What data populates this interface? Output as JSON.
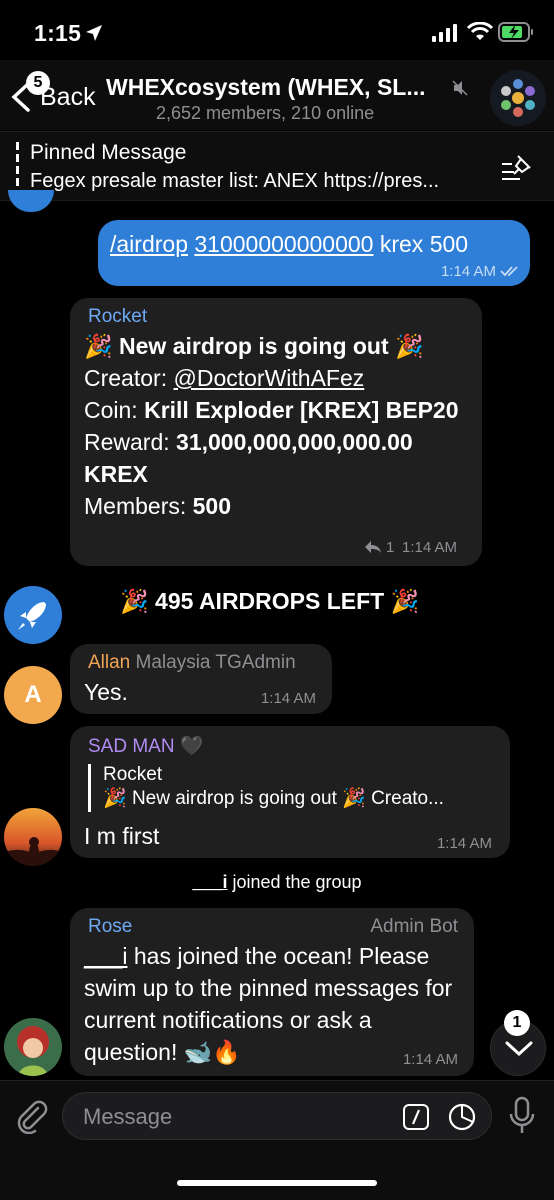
{
  "status": {
    "time": "1:15"
  },
  "header": {
    "back_label": "Back",
    "unread_count": "5",
    "title": "WHEXcosystem (WHEX, SL...",
    "subtitle": "2,652 members, 210 online"
  },
  "pinned": {
    "title": "Pinned Message",
    "text": "Fegex presale master list: ANEX https://pres..."
  },
  "messages": {
    "out": {
      "command": "/airdrop",
      "amount": "31000000000000",
      "rest": " krex 500",
      "time": "1:14 AM"
    },
    "rocket": {
      "sender": "Rocket",
      "line1": "New airdrop is going out",
      "creator_label": "Creator: ",
      "creator": "@DoctorWithAFez",
      "coin_label": "Coin: ",
      "coin": "Krill Exploder [KREX] BEP20",
      "reward_label": "Reward: ",
      "reward": "31,000,000,000,000.00 KREX",
      "members_label": "Members: ",
      "members": "500",
      "reply_count": "1",
      "time": "1:14 AM"
    },
    "airdrops_left": "495 AIRDROPS LEFT",
    "allan": {
      "sender": "Allan",
      "tag": "Malaysia TGAdmin",
      "avatar_letter": "A",
      "text": "Yes.",
      "time": "1:14 AM"
    },
    "sadman": {
      "sender": "SAD MAN",
      "reply_sender": "Rocket",
      "reply_text": "New airdrop is going out",
      "reply_tail": "Creato...",
      "text": "I m first",
      "time": "1:14 AM"
    },
    "joined": {
      "user": "___i",
      "text": " joined the group"
    },
    "rose": {
      "sender": "Rose",
      "tag": "Admin Bot",
      "user": "___i",
      "text": " has joined the ocean! Please swim up to the pinned messages for current notifications or ask a question!",
      "time": "1:14 AM"
    }
  },
  "scroll_badge": "1",
  "input": {
    "placeholder": "Message"
  },
  "colors": {
    "outgoing": "#2f7fd8",
    "rocket_name": "#6ea9f5",
    "allan_name": "#f0a456",
    "sadman_name": "#b18cf2",
    "rose_name": "#6ea9f5"
  }
}
